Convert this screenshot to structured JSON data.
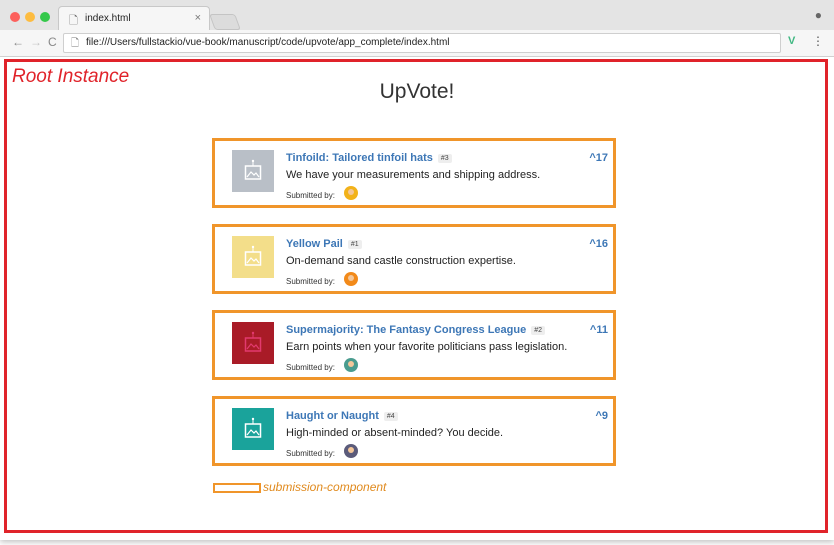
{
  "browser": {
    "tab_title": "index.html",
    "tab_close": "×",
    "tab_icon": "page-icon",
    "url": "file:///Users/fullstackio/vue-book/manuscript/code/upvote/app_complete/index.html",
    "nav": {
      "back": "←",
      "forward": "→",
      "reload": "C"
    },
    "vue_extension": "V",
    "menu": "⋮",
    "profile": "●",
    "colors": {
      "close": "#fc605c",
      "minimize": "#fdbc40",
      "zoom": "#34c84a"
    }
  },
  "annotations": {
    "root_label": "Root Instance",
    "component_label": "submission-component",
    "root_color": "#e0232a",
    "component_color": "#f0952a"
  },
  "app": {
    "title": "UpVote!",
    "submitted_by_label": "Submitted by:",
    "submissions": [
      {
        "title": "Tinfoild: Tailored tinfoil hats",
        "id_badge": "#3",
        "description": "We have your measurements and shipping address.",
        "votes": "17",
        "thumb_color": "#b9bfc7",
        "avatar_color": "#f2b21a"
      },
      {
        "title": "Yellow Pail",
        "id_badge": "#1",
        "description": "On-demand sand castle construction expertise.",
        "votes": "16",
        "thumb_color": "#f3de8a",
        "avatar_color": "#f28a1a"
      },
      {
        "title": "Supermajority: The Fantasy Congress League",
        "id_badge": "#2",
        "description": "Earn points when your favorite politicians pass legislation.",
        "votes": "11",
        "thumb_color": "#a91b27",
        "avatar_color": "#4a9c8f"
      },
      {
        "title": "Haught or Naught",
        "id_badge": "#4",
        "description": "High-minded or absent-minded? You decide.",
        "votes": "9",
        "thumb_color": "#1aa39b",
        "avatar_color": "#5b5b7a"
      }
    ]
  },
  "icons": {
    "upvote": "chevron-up-icon",
    "thumbnail": "image-placeholder-icon"
  }
}
